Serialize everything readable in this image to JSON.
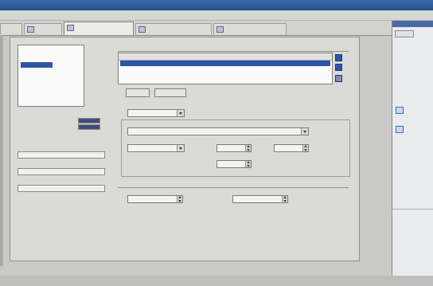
{
  "window": {
    "title": ""
  },
  "tabs": [
    {
      "label": ""
    },
    {
      "label": ""
    },
    {
      "label": ""
    },
    {
      "label": ""
    }
  ],
  "categories": [
    {
      "label": ""
    },
    {
      "label": ""
    },
    {
      "label": ""
    },
    {
      "label": ""
    },
    {
      "label": ""
    },
    {
      "label": ""
    }
  ],
  "recording_status": {
    "title": "",
    "rows": [
      {
        "label": ""
      },
      {
        "label": ""
      },
      {
        "label": ""
      }
    ],
    "sections": [
      {
        "label": ""
      },
      {
        "label": ""
      },
      {
        "label": ""
      }
    ]
  },
  "stop_list": {
    "title": "",
    "columns": [
      "",
      "",
      ""
    ],
    "rows": [
      {
        "name": "",
        "condition": ""
      }
    ]
  },
  "buttons": {
    "add": "",
    "remove": ""
  },
  "condition_type": {
    "label": "",
    "value": ""
  },
  "trigger": {
    "label": "",
    "signal": "",
    "type_label": "",
    "type_value": "",
    "value_label": "",
    "value": "",
    "hysteresis_label": "",
    "hysteresis_value": "",
    "count_label": "",
    "count_value": ""
  },
  "advanced": {
    "title": "",
    "post_label": "",
    "post_value": "",
    "threshold_label": "",
    "threshold_value": ""
  },
  "help_pane": {
    "back_label": "",
    "heading": "",
    "body": "",
    "section_heading": "",
    "section_body": ""
  },
  "colors": {
    "titlebar": "#2f5a9a",
    "selection": "#2f56a6",
    "panel": "#dadad6",
    "help_heading": "#1d2e55"
  }
}
